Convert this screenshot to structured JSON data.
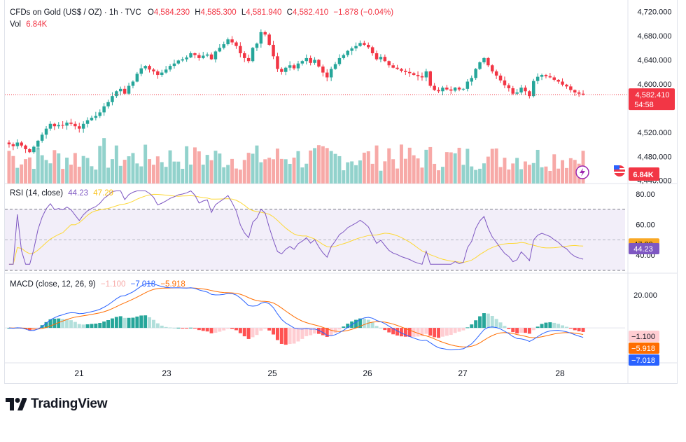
{
  "header": {
    "symbol": "CFDs on Gold (US$ / OZ) · 1h · TVC",
    "o_label": "O",
    "o_value": "4,584.230",
    "h_label": "H",
    "h_value": "4,585.300",
    "l_label": "L",
    "l_value": "4,581.940",
    "c_label": "C",
    "c_value": "4,582.410",
    "change": "−1.878 (−0.04%)",
    "vol_label": "Vol",
    "vol_value": "6.84K"
  },
  "rsi_legend": {
    "label": "RSI (14, close)",
    "value": "44.23",
    "ma_value": "47.29"
  },
  "macd_legend": {
    "label": "MACD (close, 12, 26, 9)",
    "hist": "−1.100",
    "macd": "−7.018",
    "signal": "−5.918"
  },
  "price_axis": {
    "ticks": [
      "4,720.000",
      "4,680.000",
      "4,640.000",
      "4,600.000",
      "4,520.000",
      "4,480.000",
      "4,440.000"
    ],
    "current_price": "4,582.410",
    "countdown": "54:58",
    "volume_badge": "6.84K"
  },
  "rsi_axis": {
    "ticks": [
      "80.00",
      "60.00",
      "40.00"
    ],
    "ma_badge": "47.29",
    "rsi_badge": "44.23"
  },
  "macd_axis": {
    "ticks": [
      "20.000"
    ],
    "hist_badge": "−1.100",
    "signal_badge": "−5.918",
    "macd_badge": "−7.018"
  },
  "time_axis": [
    "21",
    "23",
    "25",
    "26",
    "27",
    "28"
  ],
  "brand": {
    "logo_text": "TradingView"
  },
  "colors": {
    "up": "#26a69a",
    "down": "#f23645",
    "vol_up": "#92d2cc",
    "vol_down": "#f7a9a7",
    "rsi": "#7e57c2",
    "rsi_ma": "#fdd835",
    "macd": "#2962ff",
    "signal": "#ff6d00"
  },
  "chart_data": {
    "type": "candlestick",
    "title": "CFDs on Gold (US$ / OZ) · 1h · TVC",
    "x_ticks": [
      "21",
      "23",
      "25",
      "26",
      "27",
      "28"
    ],
    "price_ylim": [
      4430,
      4730
    ],
    "last_candle": {
      "open": 4584.23,
      "high": 4585.3,
      "low": 4581.94,
      "close": 4582.41
    },
    "close_series": [
      4500,
      4497,
      4503,
      4498,
      4492,
      4487,
      4496,
      4506,
      4516,
      4526,
      4534,
      4530,
      4532,
      4531,
      4536,
      4534,
      4530,
      4526,
      4534,
      4540,
      4544,
      4547,
      4553,
      4563,
      4570,
      4580,
      4588,
      4592,
      4584,
      4597,
      4604,
      4617,
      4626,
      4630,
      4624,
      4621,
      4615,
      4619,
      4624,
      4630,
      4634,
      4639,
      4641,
      4644,
      4651,
      4648,
      4643,
      4647,
      4649,
      4641,
      4654,
      4660,
      4666,
      4674,
      4669,
      4663,
      4651,
      4643,
      4638,
      4660,
      4667,
      4686,
      4682,
      4665,
      4646,
      4625,
      4620,
      4627,
      4631,
      4626,
      4634,
      4638,
      4643,
      4635,
      4640,
      4629,
      4619,
      4611,
      4625,
      4633,
      4643,
      4648,
      4655,
      4659,
      4663,
      4668,
      4665,
      4661,
      4651,
      4641,
      4645,
      4638,
      4631,
      4627,
      4625,
      4622,
      4620,
      4618,
      4615,
      4613,
      4611,
      4621,
      4597,
      4590,
      4588,
      4594,
      4591,
      4589,
      4594,
      4591,
      4592,
      4604,
      4610,
      4625,
      4636,
      4643,
      4631,
      4621,
      4614,
      4606,
      4598,
      4593,
      4584,
      4586,
      4594,
      4588,
      4580,
      4605,
      4612,
      4615,
      4613,
      4611,
      4607,
      4604,
      4599,
      4596,
      4590,
      4586,
      4584,
      4582.41
    ],
    "volume_ylim": [
      0,
      20000
    ],
    "rsi": {
      "period": 14,
      "value": 44.23,
      "ma": 47.29,
      "ylim": [
        30,
        85
      ],
      "bands": [
        70,
        30
      ]
    },
    "macd": {
      "fast": 12,
      "slow": 26,
      "signal": 9,
      "macd": -7.018,
      "signal_value": -5.918,
      "hist": -1.1
    }
  }
}
